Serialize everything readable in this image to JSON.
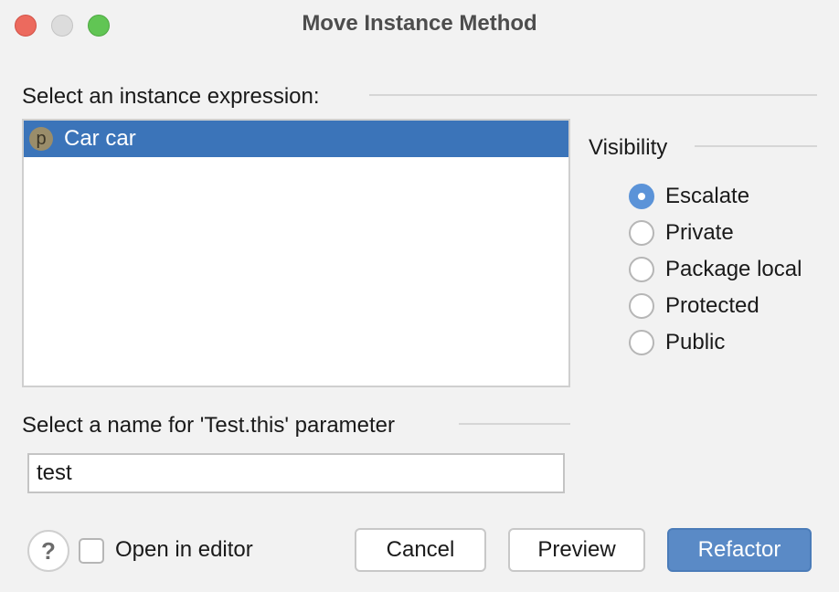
{
  "window": {
    "title": "Move Instance Method",
    "controls": [
      "close",
      "minimize",
      "maximize"
    ]
  },
  "instance_section": {
    "label": "Select an instance expression:",
    "items": [
      {
        "icon": "parameter-icon",
        "icon_letter": "p",
        "label": "Car car",
        "selected": true
      }
    ]
  },
  "visibility": {
    "label": "Visibility",
    "options": [
      {
        "label": "Escalate",
        "checked": true
      },
      {
        "label": "Private",
        "checked": false
      },
      {
        "label": "Package local",
        "checked": false
      },
      {
        "label": "Protected",
        "checked": false
      },
      {
        "label": "Public",
        "checked": false
      }
    ]
  },
  "parameter_section": {
    "label": "Select a name for 'Test.this' parameter",
    "value": "test"
  },
  "footer": {
    "help_label": "?",
    "open_in_editor_label": "Open in editor",
    "open_in_editor_checked": false,
    "cancel_label": "Cancel",
    "preview_label": "Preview",
    "refactor_label": "Refactor"
  },
  "colors": {
    "accent": "#5a8ac6",
    "selection": "#3b74b9"
  }
}
